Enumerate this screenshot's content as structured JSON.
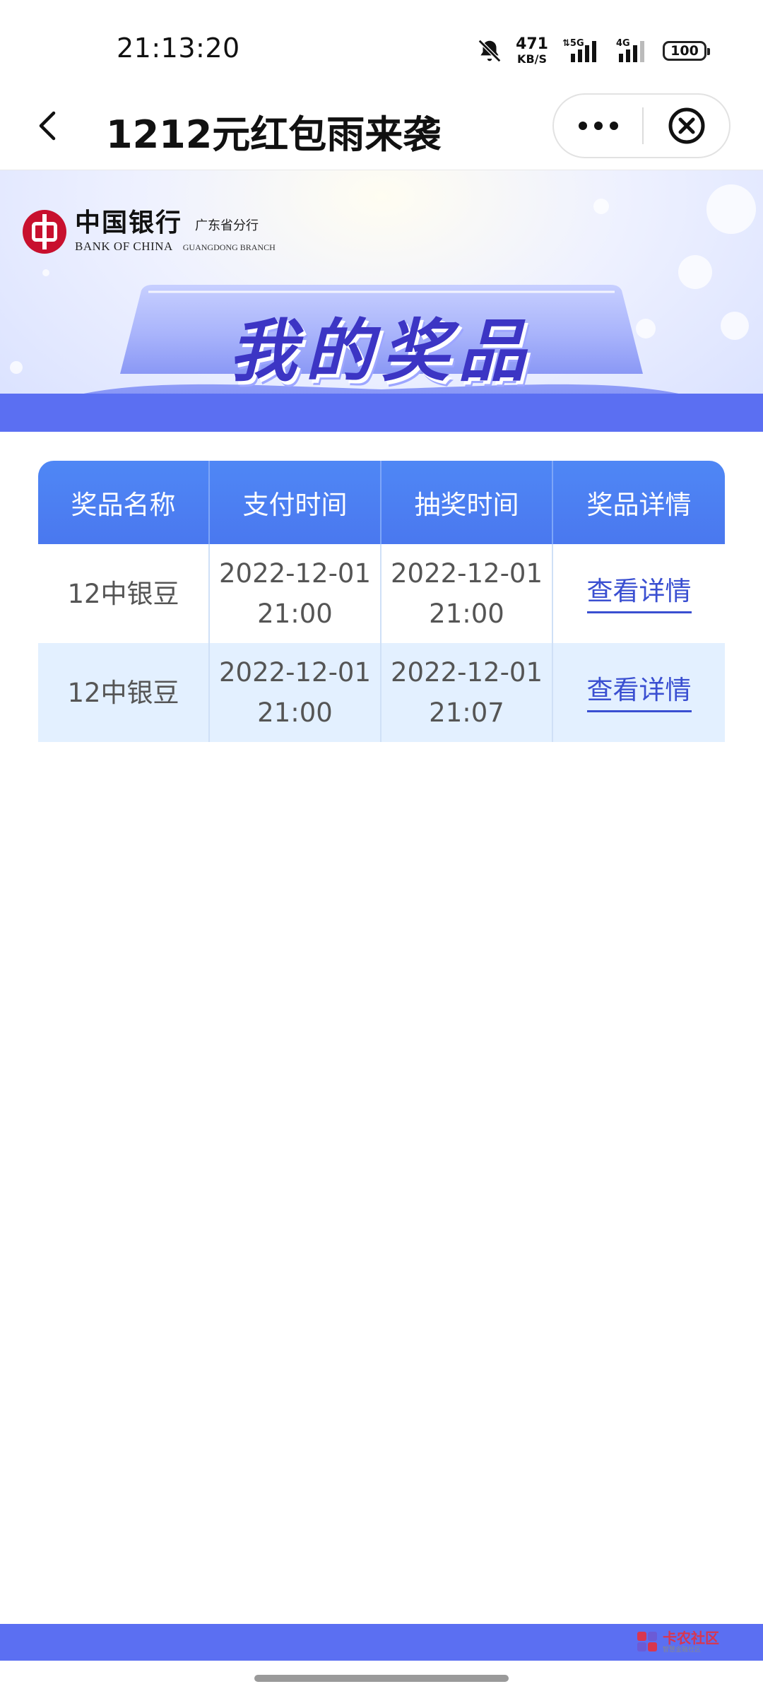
{
  "status_bar": {
    "time": "21:13:20",
    "net_speed": "471",
    "net_unit": "KB/S",
    "net_5g": "5G",
    "net_4g": "4G",
    "battery": "100"
  },
  "nav": {
    "title": "1212元红包雨来袭"
  },
  "banner": {
    "bank_name_cn": "中国银行",
    "bank_name_en": "BANK OF CHINA",
    "branch_cn": "广东省分行",
    "branch_en": "GUANGDONG BRANCH",
    "title": "我的奖品"
  },
  "table": {
    "headers": [
      "奖品名称",
      "支付时间",
      "抽奖时间",
      "奖品详情"
    ],
    "rows": [
      {
        "name": "12中银豆",
        "pay_date": "2022-12-01",
        "pay_time": "21:00",
        "draw_date": "2022-12-01",
        "draw_time": "21:00",
        "detail": "查看详情"
      },
      {
        "name": "12中银豆",
        "pay_date": "2022-12-01",
        "pay_time": "21:00",
        "draw_date": "2022-12-01",
        "draw_time": "21:07",
        "detail": "查看详情"
      }
    ]
  },
  "watermark": {
    "name": "卡农社区",
    "sub": "智慧金融社区"
  },
  "colors": {
    "header_blue": "#4f87f5",
    "stripe_blue": "#5b6ff2",
    "link_blue": "#3a4fd1",
    "row_alt": "#e3f0ff"
  }
}
